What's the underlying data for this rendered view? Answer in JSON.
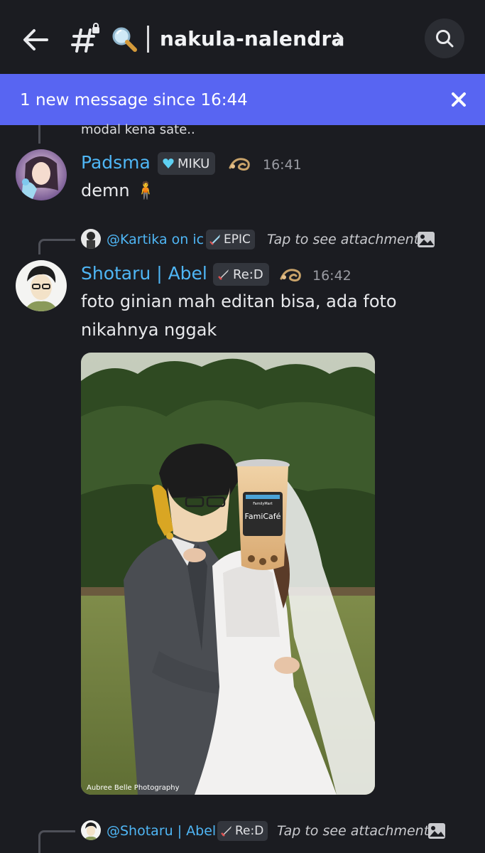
{
  "header": {
    "channel_name": "nakula-nalendra",
    "back_icon": "arrow-left-icon",
    "channel_icon": "hashtag-lock-icon",
    "search_emoji": "magnifier-emoji",
    "search_icon": "search-icon"
  },
  "banner": {
    "text": "1 new message since 16:44",
    "close_icon": "close-icon",
    "color": "#5865f2"
  },
  "previous_message": {
    "text": "modal kena sate.."
  },
  "messages": [
    {
      "author": "Padsma",
      "badge": "MIKU",
      "badge_icon": "heart-gem-icon",
      "role_icon": "dragon-icon",
      "time": "16:41",
      "text": "demn 🧍"
    },
    {
      "reply": {
        "author": "@Kartika on ic",
        "badge": "EPIC",
        "badge_icon": "sword-icon",
        "text": "Tap to see attachment"
      },
      "author": "Shotaru | Abel",
      "badge": "Re:D",
      "badge_icon": "crossed-swords-icon",
      "role_icon": "dragon-icon",
      "time": "16:42",
      "text_line1": "foto ginian mah editan bisa, ada foto",
      "text_line2": "nikahnya nggak",
      "attachment": {
        "credit": "Aubree Belle Photography",
        "cup_brand": "FamiCafé",
        "cup_store": "FamilyMart"
      }
    }
  ],
  "next_reply": {
    "author": "@Shotaru | Abel",
    "badge": "Re:D",
    "badge_icon": "crossed-swords-icon",
    "text": "Tap to see attachment"
  },
  "colors": {
    "background": "#1b1c21",
    "username": "#4fb6f5",
    "accent": "#5865f2"
  }
}
